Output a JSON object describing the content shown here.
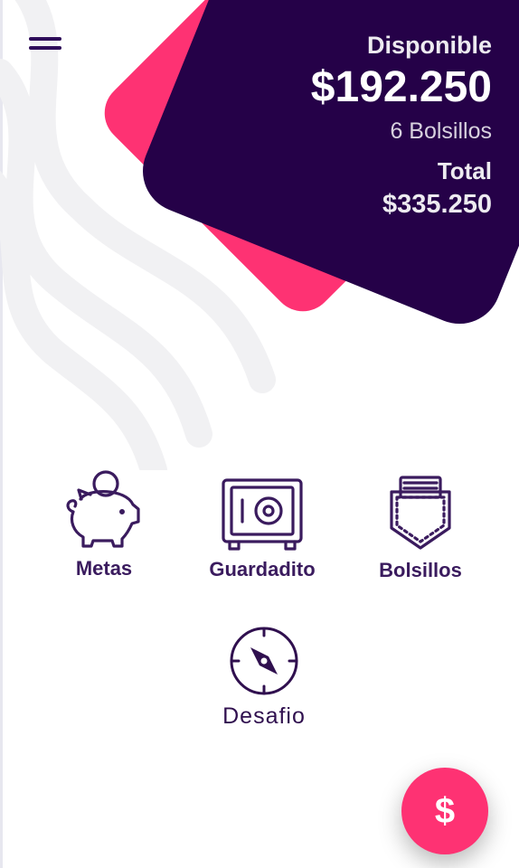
{
  "header": {
    "available_label": "Disponible",
    "available_amount": "$192.250",
    "pockets_count": "6 Bolsillos",
    "total_label": "Total",
    "total_amount": "$335.250"
  },
  "features": [
    {
      "label": "Metas",
      "icon": "piggy-bank-icon"
    },
    {
      "label": "Guardadito",
      "icon": "safe-icon"
    },
    {
      "label": "Bolsillos",
      "icon": "pocket-icon"
    },
    {
      "label": "Desafio",
      "icon": "compass-icon"
    }
  ],
  "fab": {
    "icon_label": "$",
    "icon": "dollar-icon"
  },
  "menu": {
    "icon": "hamburger-menu-icon"
  },
  "colors": {
    "brand_dark": "#250148",
    "brand_pink": "#fe3273",
    "icon_purple": "#3a1b5e"
  }
}
